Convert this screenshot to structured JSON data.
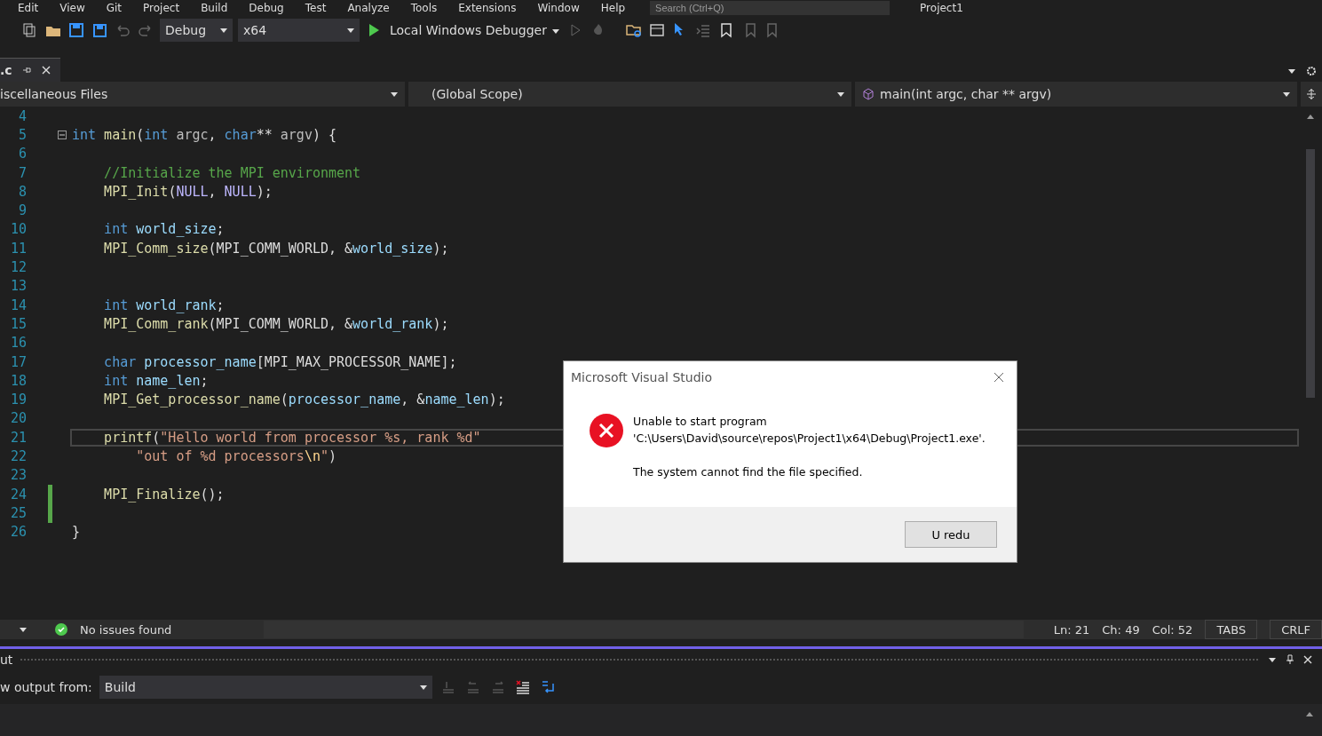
{
  "menu": [
    "Edit",
    "View",
    "Git",
    "Project",
    "Build",
    "Debug",
    "Test",
    "Analyze",
    "Tools",
    "Extensions",
    "Window",
    "Help"
  ],
  "search": {
    "placeholder": "Search (Ctrl+Q)"
  },
  "solution_name": "Project1",
  "toolbar": {
    "configuration": "Debug",
    "platform": "x64",
    "debugger": "Local Windows Debugger"
  },
  "tab": {
    "label": ".c",
    "selected": true
  },
  "nav": {
    "project": "iscellaneous Files",
    "scope": "(Global Scope)",
    "member": "main(int argc, char ** argv)"
  },
  "code": {
    "lines": [
      {
        "n": "4",
        "changed": false,
        "current": false
      },
      {
        "n": "5",
        "changed": false,
        "current": false,
        "collapse": true,
        "tokens": [
          {
            "t": "int",
            "kind": "kw"
          },
          {
            "t": " main",
            "kind": "fn"
          },
          {
            "t": "(",
            "kind": "plain"
          },
          {
            "t": "int",
            "kind": "kw"
          },
          {
            "t": " argc",
            "kind": "param"
          },
          {
            "t": ", ",
            "kind": "plain"
          },
          {
            "t": "char",
            "kind": "kw"
          },
          {
            "t": "** ",
            "kind": "plain"
          },
          {
            "t": "argv",
            "kind": "param"
          },
          {
            "t": ") {",
            "kind": "plain"
          }
        ]
      },
      {
        "n": "6",
        "changed": false,
        "current": false
      },
      {
        "n": "7",
        "changed": false,
        "current": false,
        "tokens": [
          {
            "t": "    //Initialize the MPI environment",
            "kind": "comment"
          }
        ]
      },
      {
        "n": "8",
        "changed": false,
        "current": false,
        "tokens": [
          {
            "t": "    MPI_Init",
            "kind": "fn"
          },
          {
            "t": "(",
            "kind": "plain"
          },
          {
            "t": "NULL",
            "kind": "macro"
          },
          {
            "t": ", ",
            "kind": "plain"
          },
          {
            "t": "NULL",
            "kind": "macro"
          },
          {
            "t": ");",
            "kind": "plain"
          }
        ]
      },
      {
        "n": "9",
        "changed": false,
        "current": false
      },
      {
        "n": "10",
        "changed": false,
        "current": false,
        "tokens": [
          {
            "t": "    int",
            "kind": "kw"
          },
          {
            "t": " world_size",
            "kind": "local"
          },
          {
            "t": ";",
            "kind": "plain"
          }
        ]
      },
      {
        "n": "11",
        "changed": false,
        "current": false,
        "tokens": [
          {
            "t": "    MPI_Comm_size",
            "kind": "fn"
          },
          {
            "t": "(MPI_COMM_WORLD, &",
            "kind": "plain"
          },
          {
            "t": "world_size",
            "kind": "local"
          },
          {
            "t": ");",
            "kind": "plain"
          }
        ]
      },
      {
        "n": "12",
        "changed": false,
        "current": false
      },
      {
        "n": "13",
        "changed": false,
        "current": false
      },
      {
        "n": "14",
        "changed": false,
        "current": false,
        "tokens": [
          {
            "t": "    int",
            "kind": "kw"
          },
          {
            "t": " world_rank",
            "kind": "local"
          },
          {
            "t": ";",
            "kind": "plain"
          }
        ]
      },
      {
        "n": "15",
        "changed": false,
        "current": false,
        "tokens": [
          {
            "t": "    MPI_Comm_rank",
            "kind": "fn"
          },
          {
            "t": "(MPI_COMM_WORLD, &",
            "kind": "plain"
          },
          {
            "t": "world_rank",
            "kind": "local"
          },
          {
            "t": ");",
            "kind": "plain"
          }
        ]
      },
      {
        "n": "16",
        "changed": false,
        "current": false
      },
      {
        "n": "17",
        "changed": false,
        "current": false,
        "tokens": [
          {
            "t": "    char",
            "kind": "kw"
          },
          {
            "t": " processor_name",
            "kind": "local"
          },
          {
            "t": "[MPI_MAX_PROCESSOR_NAME];",
            "kind": "plain"
          }
        ]
      },
      {
        "n": "18",
        "changed": false,
        "current": false,
        "tokens": [
          {
            "t": "    int",
            "kind": "kw"
          },
          {
            "t": " name_len",
            "kind": "local"
          },
          {
            "t": ";",
            "kind": "plain"
          }
        ]
      },
      {
        "n": "19",
        "changed": false,
        "current": false,
        "tokens": [
          {
            "t": "    MPI_Get_processor_name",
            "kind": "fn"
          },
          {
            "t": "(",
            "kind": "plain"
          },
          {
            "t": "processor_name",
            "kind": "local"
          },
          {
            "t": ", &",
            "kind": "plain"
          },
          {
            "t": "name_len",
            "kind": "local"
          },
          {
            "t": ");",
            "kind": "plain"
          }
        ]
      },
      {
        "n": "20",
        "changed": false,
        "current": false
      },
      {
        "n": "21",
        "changed": false,
        "current": true,
        "tokens": [
          {
            "t": "    printf",
            "kind": "fn"
          },
          {
            "t": "(",
            "kind": "plain"
          },
          {
            "t": "\"Hello world from processor %s, rank %d\"",
            "kind": "str"
          }
        ]
      },
      {
        "n": "22",
        "changed": false,
        "current": false,
        "tokens": [
          {
            "t": "        \"out of %d processors",
            "kind": "str"
          },
          {
            "t": "\\n",
            "kind": "esc"
          },
          {
            "t": "\"",
            "kind": "str"
          },
          {
            "t": ")",
            "kind": "plain"
          }
        ]
      },
      {
        "n": "23",
        "changed": false,
        "current": false
      },
      {
        "n": "24",
        "changed": true,
        "current": false,
        "tokens": [
          {
            "t": "    MPI_Finalize",
            "kind": "fn"
          },
          {
            "t": "();",
            "kind": "plain"
          }
        ]
      },
      {
        "n": "25",
        "changed": true,
        "current": false
      },
      {
        "n": "26",
        "changed": false,
        "current": false,
        "tokens": [
          {
            "t": "}",
            "kind": "plain"
          }
        ]
      }
    ]
  },
  "dialog": {
    "title": "Microsoft Visual Studio",
    "message": "Unable to start program",
    "path": "'C:\\Users\\David\\source\\repos\\Project1\\x64\\Debug\\Project1.exe'.",
    "detail": "The system cannot find the file specified.",
    "button": "U redu"
  },
  "status": {
    "issues": "No issues found",
    "ln": "Ln: 21",
    "ch": "Ch: 49",
    "col": "Col: 52",
    "tabs": "TABS",
    "eol": "CRLF"
  },
  "output": {
    "title": "ut",
    "show_label": "w output from:",
    "source": "Build"
  }
}
